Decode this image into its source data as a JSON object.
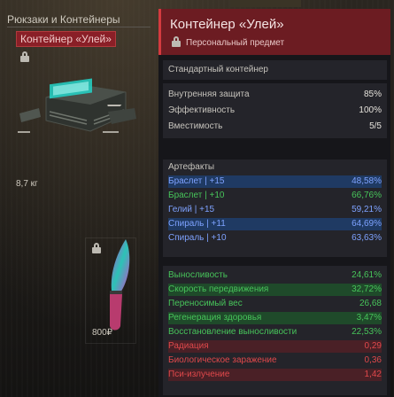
{
  "inventory": {
    "category_label": "Рюкзаки и Контейнеры",
    "selected_item": "Контейнер «Улей»",
    "weight": "8,7 кг",
    "price": "800₽"
  },
  "tooltip": {
    "title": "Контейнер «Улей»",
    "subtitle": "Персональный предмет",
    "type": "Стандартный контейнер",
    "base_stats": [
      {
        "label": "Внутренняя защита",
        "value": "85%"
      },
      {
        "label": "Эффективность",
        "value": "100%"
      },
      {
        "label": "Вместимость",
        "value": "5/5"
      }
    ],
    "artifacts_header": "Артефакты",
    "artifacts": [
      {
        "name": "Браслет | +15",
        "value": "48,58%",
        "color": "blue"
      },
      {
        "name": "Браслет | +10",
        "value": "66,76%",
        "color": "green"
      },
      {
        "name": "Гелий | +15",
        "value": "59,21%",
        "color": "blue"
      },
      {
        "name": "Спираль | +11",
        "value": "64,69%",
        "color": "blue"
      },
      {
        "name": "Спираль | +10",
        "value": "63,63%",
        "color": "blue"
      }
    ],
    "effects": [
      {
        "label": "Выносливость",
        "value": "24,61%",
        "color": "green"
      },
      {
        "label": "Скорость передвижения",
        "value": "32,72%",
        "color": "green"
      },
      {
        "label": "Переносимый вес",
        "value": "26,68",
        "color": "green"
      },
      {
        "label": "Регенерация здоровья",
        "value": "3,47%",
        "color": "green"
      },
      {
        "label": "Восстановление выносливости",
        "value": "22,53%",
        "color": "green"
      },
      {
        "label": "Радиация",
        "value": "0,29",
        "color": "red"
      },
      {
        "label": "Биологическое заражение",
        "value": "0,36",
        "color": "red"
      },
      {
        "label": "Пси-излучение",
        "value": "1,42",
        "color": "red"
      }
    ]
  }
}
